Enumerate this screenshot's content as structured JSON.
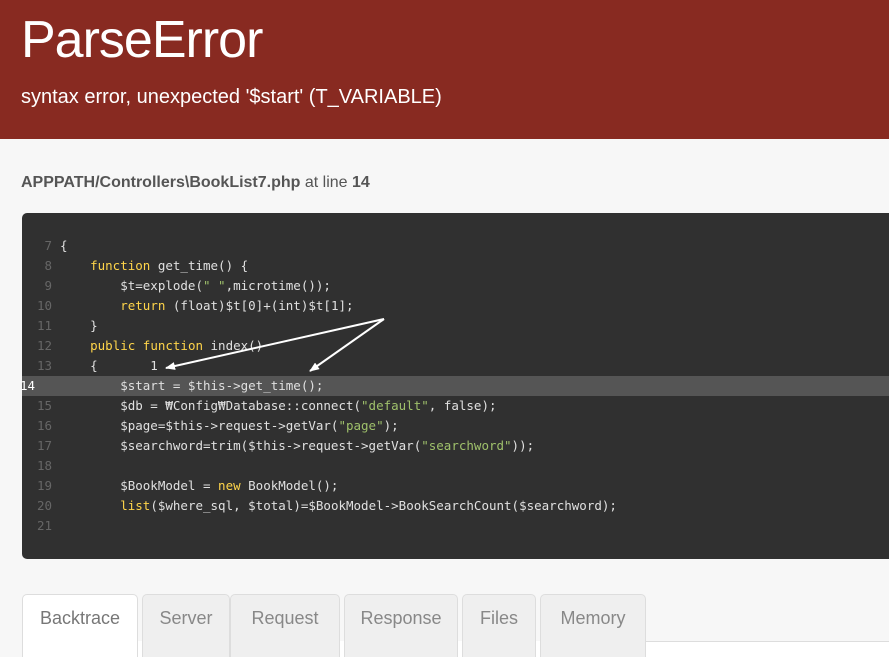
{
  "header": {
    "title": "ParseError",
    "subtitle": "syntax error, unexpected '$start' (T_VARIABLE)"
  },
  "location": {
    "file": "APPPATH/Controllers\\BookList7.php",
    "at_line_text": " at line ",
    "line": "14"
  },
  "code": {
    "highlight_line": "14",
    "lines": [
      {
        "n": "7",
        "parts": [
          [
            "p",
            "{"
          ]
        ]
      },
      {
        "n": "8",
        "parts": [
          [
            "p",
            "    "
          ],
          [
            "k",
            "function"
          ],
          [
            "p",
            " get_time() {"
          ]
        ]
      },
      {
        "n": "9",
        "parts": [
          [
            "p",
            "        $t=explode("
          ],
          [
            "s",
            "\" \""
          ],
          [
            "p",
            ",microtime());"
          ]
        ]
      },
      {
        "n": "10",
        "parts": [
          [
            "p",
            "        "
          ],
          [
            "k",
            "return"
          ],
          [
            "p",
            " (float)$t[0]+(int)$t[1];"
          ]
        ]
      },
      {
        "n": "11",
        "parts": [
          [
            "p",
            "    }"
          ]
        ]
      },
      {
        "n": "12",
        "parts": [
          [
            "p",
            "    "
          ],
          [
            "k",
            "public function"
          ],
          [
            "p",
            " index()"
          ]
        ]
      },
      {
        "n": "13",
        "parts": [
          [
            "p",
            "    {       1"
          ]
        ]
      },
      {
        "n": "14",
        "parts": [
          [
            "p",
            "        $start = $this->get_time();"
          ]
        ]
      },
      {
        "n": "15",
        "parts": [
          [
            "p",
            "        $db = ₩Config₩Database::connect("
          ],
          [
            "s",
            "\"default\""
          ],
          [
            "p",
            ", false);"
          ]
        ]
      },
      {
        "n": "16",
        "parts": [
          [
            "p",
            "        $page=$this->request->getVar("
          ],
          [
            "s",
            "\"page\""
          ],
          [
            "p",
            ");"
          ]
        ]
      },
      {
        "n": "17",
        "parts": [
          [
            "p",
            "        $searchword=trim($this->request->getVar("
          ],
          [
            "s",
            "\"searchword\""
          ],
          [
            "p",
            "));"
          ]
        ]
      },
      {
        "n": "18",
        "parts": [
          [
            "p",
            ""
          ]
        ]
      },
      {
        "n": "19",
        "parts": [
          [
            "p",
            "        $BookModel = "
          ],
          [
            "k",
            "new"
          ],
          [
            "p",
            " BookModel();"
          ]
        ]
      },
      {
        "n": "20",
        "parts": [
          [
            "p",
            "        "
          ],
          [
            "k",
            "list"
          ],
          [
            "p",
            "($where_sql, $total)=$BookModel->BookSearchCount($searchword);"
          ]
        ]
      },
      {
        "n": "21",
        "parts": [
          [
            "p",
            ""
          ]
        ]
      }
    ]
  },
  "colors": {
    "header_bg": "#882a21",
    "code_bg": "#303030",
    "keyword": "#ffd54a",
    "string": "#9fc16b"
  },
  "tabs": [
    {
      "label": "Backtrace",
      "active": true
    },
    {
      "label": "Server",
      "active": false
    },
    {
      "label": "Request",
      "active": false
    },
    {
      "label": "Response",
      "active": false
    },
    {
      "label": "Files",
      "active": false
    },
    {
      "label": "Memory",
      "active": false
    }
  ]
}
